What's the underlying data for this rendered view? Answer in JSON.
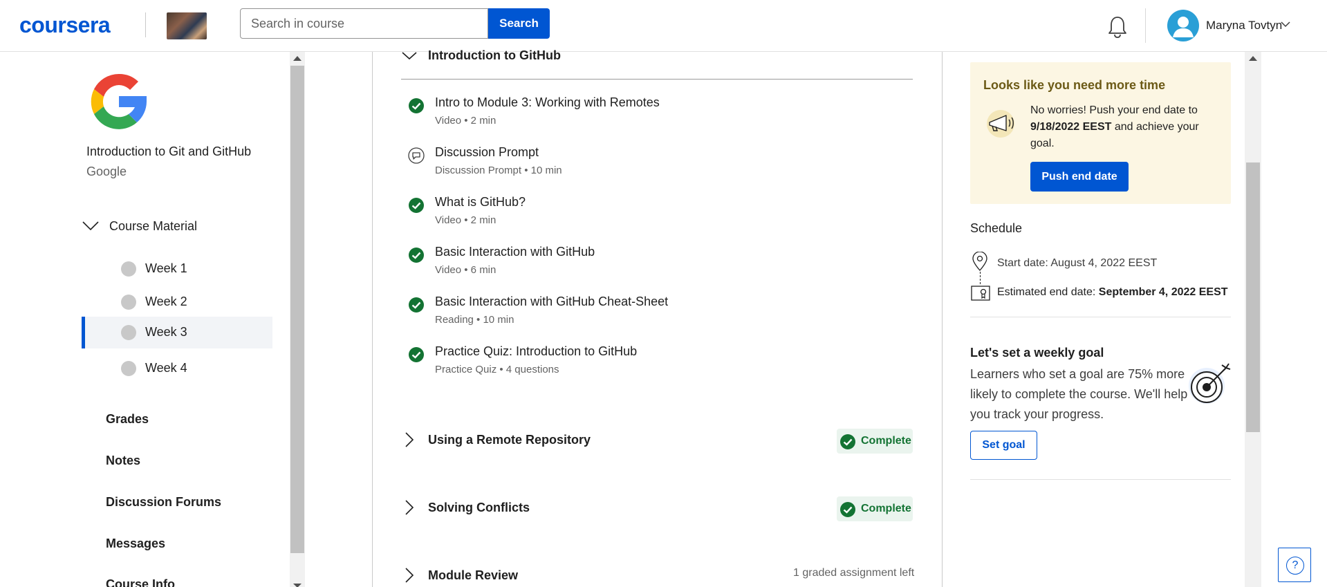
{
  "header": {
    "logo": "coursera",
    "search_placeholder": "Search in course",
    "search_button": "Search",
    "user_name": "Maryna Tovtyn"
  },
  "sidebar": {
    "course_title": "Introduction to Git and GitHub",
    "course_org": "Google",
    "course_material_label": "Course Material",
    "weeks": [
      {
        "label": "Week 1"
      },
      {
        "label": "Week 2"
      },
      {
        "label": "Week 3",
        "active": true
      },
      {
        "label": "Week 4"
      }
    ],
    "links": [
      "Grades",
      "Notes",
      "Discussion Forums",
      "Messages",
      "Course Info"
    ]
  },
  "main": {
    "open_section": "Introduction to GitHub",
    "items": [
      {
        "name": "Intro to Module 3: Working with Remotes",
        "meta": "Video • 2 min",
        "status": "complete"
      },
      {
        "name": "Discussion Prompt",
        "meta": "Discussion Prompt • 10 min",
        "status": "discussion"
      },
      {
        "name": "What is GitHub?",
        "meta": "Video • 2 min",
        "status": "complete"
      },
      {
        "name": "Basic Interaction with GitHub",
        "meta": "Video • 6 min",
        "status": "complete"
      },
      {
        "name": "Basic Interaction with GitHub Cheat-Sheet",
        "meta": "Reading • 10 min",
        "status": "complete"
      },
      {
        "name": "Practice Quiz: Introduction to GitHub",
        "meta": "Practice Quiz • 4 questions",
        "status": "complete"
      }
    ],
    "sections": [
      {
        "title": "Using a Remote Repository",
        "badge": "Complete"
      },
      {
        "title": "Solving Conflicts",
        "badge": "Complete"
      },
      {
        "title": "Module Review",
        "note": "1 graded assignment left"
      }
    ]
  },
  "right_panel": {
    "more_time": {
      "title": "Looks like you need more time",
      "text_before": "No worries! Push your end date to ",
      "new_date": "9/18/2022 EEST",
      "text_after": " and achieve your goal.",
      "button": "Push end date"
    },
    "schedule": {
      "title": "Schedule",
      "start": "Start date: August 4, 2022 EEST",
      "end_label": "Estimated end date: ",
      "end_value": "September 4, 2022 EEST"
    },
    "goal": {
      "title": "Let's set a weekly goal",
      "text": "Learners who set a goal are 75% more likely to complete the course. We'll help you track your progress.",
      "button": "Set goal"
    }
  },
  "help": {
    "label": "?"
  },
  "colors": {
    "brand": "#0056d2",
    "success": "#137333",
    "success_bg": "#eaf4ee",
    "notice_bg": "#fcf6e3"
  },
  "icons": [
    "bell-icon",
    "avatar-icon",
    "chevron-down-icon",
    "google-logo",
    "check-circle-icon",
    "discussion-icon",
    "map-pin-icon",
    "certificate-icon",
    "megaphone-icon",
    "target-icon",
    "help-icon"
  ]
}
